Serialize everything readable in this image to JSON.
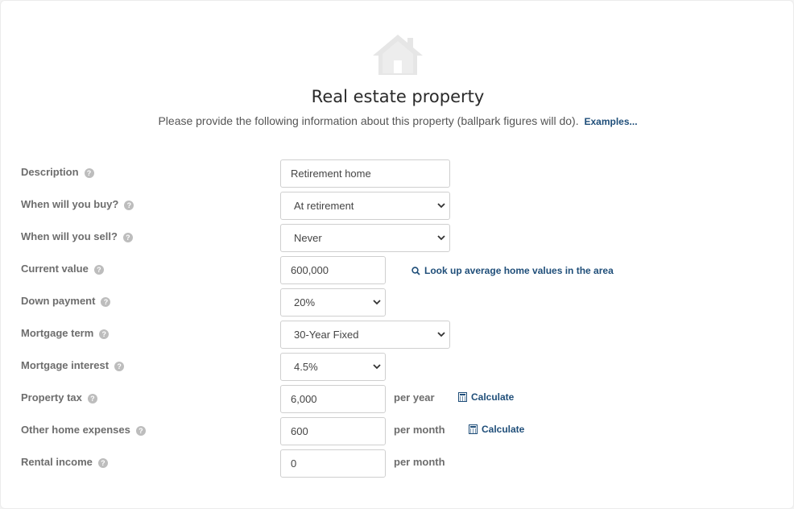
{
  "header": {
    "title": "Real estate property",
    "subtitle": "Please provide the following information about this property (ballpark figures will do).",
    "examples_link": "Examples..."
  },
  "icons": {
    "main": "house-icon",
    "help": "question-circle-icon",
    "search": "search-icon",
    "calculator": "calculator-icon"
  },
  "colors": {
    "link": "#1f4e79",
    "label": "#6d6d6d",
    "help_icon": "#bdbdbd"
  },
  "fields": {
    "description": {
      "label": "Description",
      "value": "Retirement home"
    },
    "buy": {
      "label": "When will you buy?",
      "value": "At retirement"
    },
    "sell": {
      "label": "When will you sell?",
      "value": "Never"
    },
    "current_value": {
      "label": "Current value",
      "value": "600,000",
      "lookup_link": "Look up average home values in the area"
    },
    "down_payment": {
      "label": "Down payment",
      "value": "20%"
    },
    "mortgage_term": {
      "label": "Mortgage term",
      "value": "30-Year Fixed"
    },
    "mortgage_interest": {
      "label": "Mortgage interest",
      "value": "4.5%"
    },
    "property_tax": {
      "label": "Property tax",
      "value": "6,000",
      "unit": "per year",
      "calc_link": "Calculate"
    },
    "other_expenses": {
      "label": "Other home expenses",
      "value": "600",
      "unit": "per month",
      "calc_link": "Calculate"
    },
    "rental_income": {
      "label": "Rental income",
      "value": "0",
      "unit": "per month"
    }
  }
}
